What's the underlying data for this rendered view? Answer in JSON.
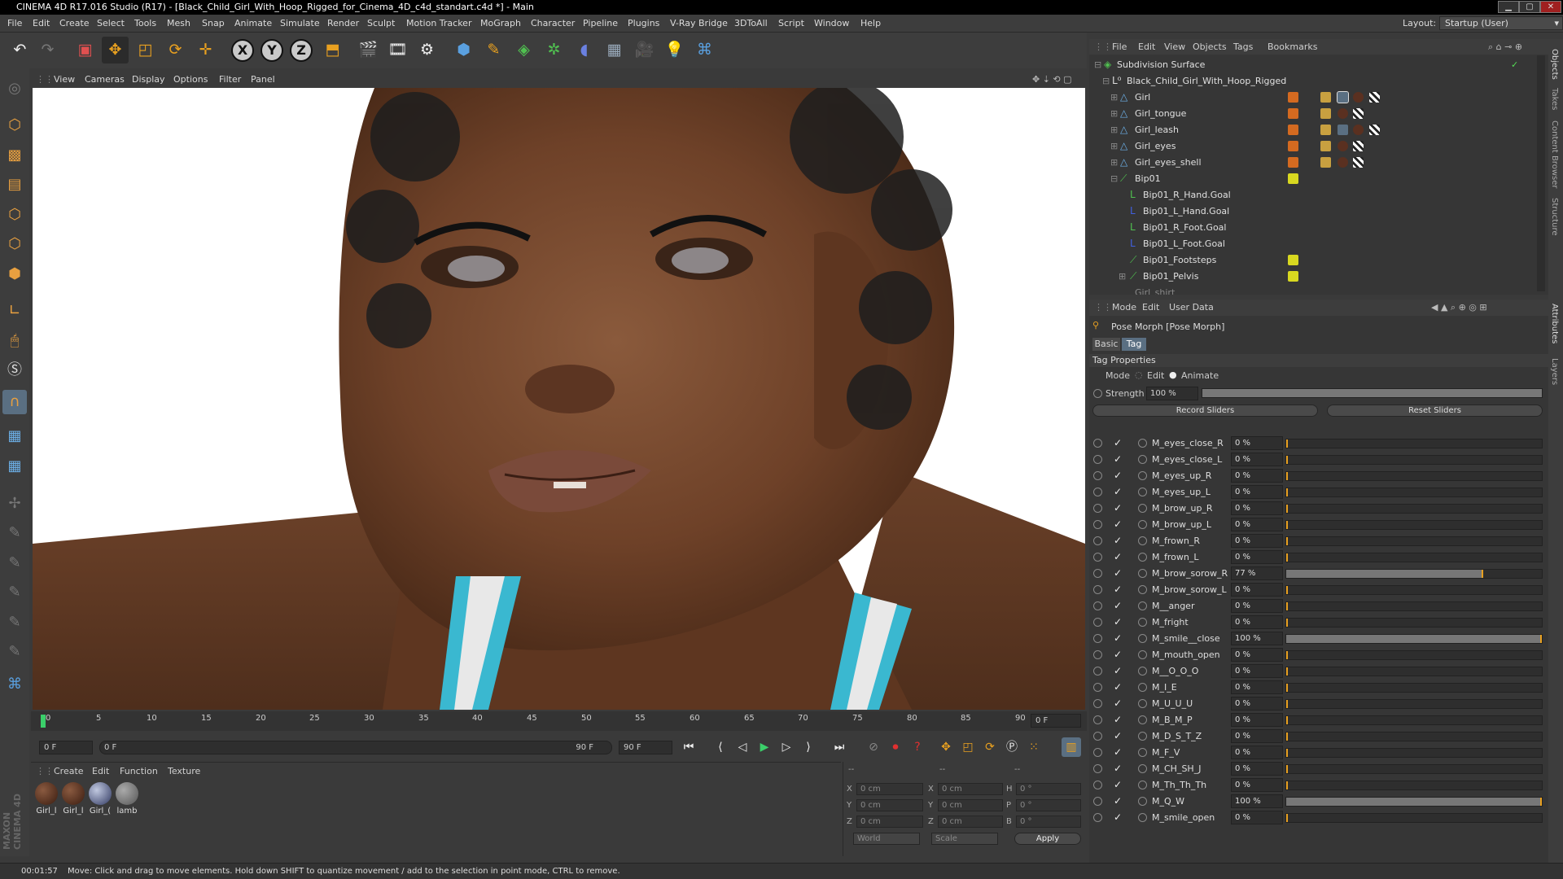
{
  "window": {
    "title": "CINEMA 4D R17.016 Studio (R17) - [Black_Child_Girl_With_Hoop_Rigged_for_Cinema_4D_c4d_standart.c4d *] - Main"
  },
  "menu": [
    "File",
    "Edit",
    "Create",
    "Select",
    "Tools",
    "Mesh",
    "Snap",
    "Animate",
    "Simulate",
    "Render",
    "Sculpt",
    "Motion Tracker",
    "MoGraph",
    "Character",
    "Pipeline",
    "Plugins",
    "V-Ray Bridge",
    "3DToAll",
    "Script",
    "Window",
    "Help"
  ],
  "layout": {
    "label": "Layout:",
    "value": "Startup (User)"
  },
  "viewport_menu": [
    "View",
    "Cameras",
    "Display",
    "Options",
    "Filter",
    "Panel"
  ],
  "timeline": {
    "ticks": [
      "0",
      "5",
      "10",
      "15",
      "20",
      "25",
      "30",
      "35",
      "40",
      "45",
      "50",
      "55",
      "60",
      "65",
      "70",
      "75",
      "80",
      "85",
      "90"
    ],
    "current_frame": "0 F"
  },
  "transport": {
    "start": "0 F",
    "range_start": "0 F",
    "range_end": "90 F",
    "end": "90 F"
  },
  "materials": {
    "menu": [
      "Create",
      "Edit",
      "Function",
      "Texture"
    ],
    "items": [
      "Girl_l",
      "Girl_l",
      "Girl_(",
      "lamb"
    ]
  },
  "coords": {
    "header": [
      "--",
      "--",
      "--"
    ],
    "rows": [
      {
        "a": "X",
        "av": "0 cm",
        "b": "X",
        "bv": "0 cm",
        "c": "H",
        "cv": "0 °"
      },
      {
        "a": "Y",
        "av": "0 cm",
        "b": "Y",
        "bv": "0 cm",
        "c": "P",
        "cv": "0 °"
      },
      {
        "a": "Z",
        "av": "0 cm",
        "b": "Z",
        "bv": "0 cm",
        "c": "B",
        "cv": "0 °"
      }
    ],
    "world": "World",
    "scale": "Scale",
    "apply": "Apply"
  },
  "status": {
    "time": "00:01:57",
    "message": "Move: Click and drag to move elements. Hold down SHIFT to quantize movement / add to the selection in point mode, CTRL to remove."
  },
  "objects": {
    "menu": [
      "File",
      "Edit",
      "View",
      "Objects",
      "Tags",
      "Bookmarks"
    ],
    "tree": [
      {
        "name": "Subdivision Surface"
      },
      {
        "name": "Black_Child_Girl_With_Hoop_Rigged"
      },
      {
        "name": "Girl"
      },
      {
        "name": "Girl_tongue"
      },
      {
        "name": "Girl_leash"
      },
      {
        "name": "Girl_eyes"
      },
      {
        "name": "Girl_eyes_shell"
      },
      {
        "name": "Bip01"
      },
      {
        "name": "Bip01_R_Hand.Goal"
      },
      {
        "name": "Bip01_L_Hand.Goal"
      },
      {
        "name": "Bip01_R_Foot.Goal"
      },
      {
        "name": "Bip01_L_Foot.Goal"
      },
      {
        "name": "Bip01_Footsteps"
      },
      {
        "name": "Bip01_Pelvis"
      },
      {
        "name": "Girl_shirt"
      }
    ]
  },
  "attributes": {
    "menu": [
      "Mode",
      "Edit",
      "User Data"
    ],
    "object_title": "Pose Morph [Pose Morph]",
    "tabs": [
      "Basic",
      "Tag"
    ],
    "section": "Tag Properties",
    "mode_label": "Mode",
    "mode_options": [
      "Edit",
      "Animate"
    ],
    "strength_label": "Strength",
    "strength_value": "100 %",
    "strength": 1.0,
    "record_label": "Record Sliders",
    "reset_label": "Reset Sliders",
    "morphs": [
      {
        "name": "M_eyes_close_R",
        "value": "0 %",
        "level": 0
      },
      {
        "name": "M_eyes_close_L",
        "value": "0 %",
        "level": 0
      },
      {
        "name": "M_eyes_up_R",
        "value": "0 %",
        "level": 0
      },
      {
        "name": "M_eyes_up_L",
        "value": "0 %",
        "level": 0
      },
      {
        "name": "M_brow_up_R",
        "value": "0 %",
        "level": 0
      },
      {
        "name": "M_brow_up_L",
        "value": "0 %",
        "level": 0
      },
      {
        "name": "M_frown_R",
        "value": "0 %",
        "level": 0
      },
      {
        "name": "M_frown_L",
        "value": "0 %",
        "level": 0
      },
      {
        "name": "M_brow_sorow_R",
        "value": "77 %",
        "level": 0.77
      },
      {
        "name": "M_brow_sorow_L",
        "value": "0 %",
        "level": 0
      },
      {
        "name": "M__anger",
        "value": "0 %",
        "level": 0
      },
      {
        "name": "M_fright",
        "value": "0 %",
        "level": 0
      },
      {
        "name": "M_smile__close",
        "value": "100 %",
        "level": 1
      },
      {
        "name": "M_mouth_open",
        "value": "0 %",
        "level": 0
      },
      {
        "name": "M__O_O_O",
        "value": "0 %",
        "level": 0
      },
      {
        "name": "M_I_E",
        "value": "0 %",
        "level": 0
      },
      {
        "name": "M_U_U_U",
        "value": "0 %",
        "level": 0
      },
      {
        "name": "M_B_M_P",
        "value": "0 %",
        "level": 0
      },
      {
        "name": "M_D_S_T_Z",
        "value": "0 %",
        "level": 0
      },
      {
        "name": "M_F_V",
        "value": "0 %",
        "level": 0
      },
      {
        "name": "M_CH_SH_J",
        "value": "0 %",
        "level": 0
      },
      {
        "name": "M_Th_Th_Th",
        "value": "0 %",
        "level": 0
      },
      {
        "name": "M_Q_W",
        "value": "100 %",
        "level": 1
      },
      {
        "name": "M_smile_open",
        "value": "0 %",
        "level": 0
      }
    ]
  },
  "side_tabs": [
    "Objects",
    "Takes",
    "Content Browser",
    "Structure",
    "Attributes",
    "Layers"
  ],
  "logo": {
    "line1": "MAXON",
    "line2": "CINEMA 4D"
  },
  "colors": {
    "accent": "#e8a020",
    "selected": "#5a6f82",
    "tag_orange": "#d46a20",
    "tag_yellow": "#d8d820"
  },
  "icons": [
    "undo-icon",
    "redo-icon",
    "live-select-icon",
    "move-icon",
    "scale-icon",
    "rotate-icon",
    "x-axis-icon",
    "y-axis-icon",
    "z-axis-icon",
    "render-icon",
    "cube-icon",
    "light-icon",
    "python-icon"
  ]
}
